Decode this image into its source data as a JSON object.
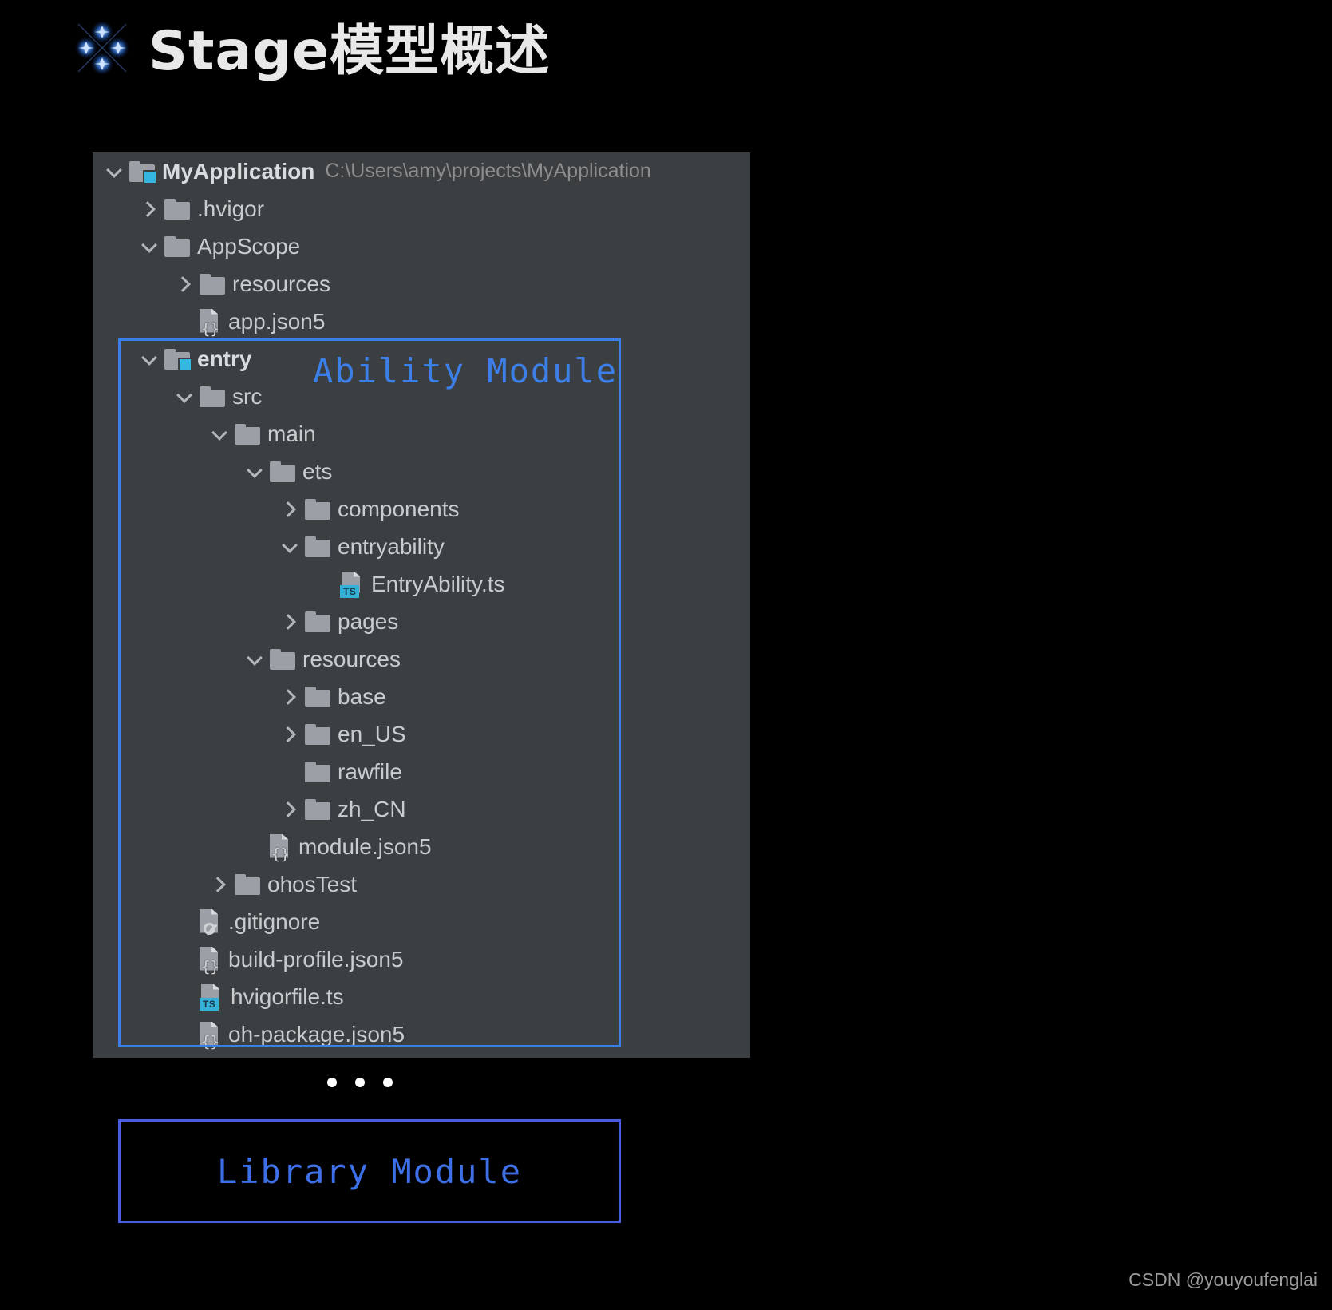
{
  "header": {
    "title": "Stage模型概述",
    "icon": "sparkle-icon"
  },
  "tree": {
    "rows": [
      {
        "indent": 0,
        "chevron": "down",
        "icon": "folder-module",
        "label": "MyApplication",
        "bold": true,
        "path": "C:\\Users\\amy\\projects\\MyApplication"
      },
      {
        "indent": 1,
        "chevron": "right",
        "icon": "folder",
        "label": ".hvigor",
        "bold": false,
        "path": ""
      },
      {
        "indent": 1,
        "chevron": "down",
        "icon": "folder",
        "label": "AppScope",
        "bold": false,
        "path": ""
      },
      {
        "indent": 2,
        "chevron": "right",
        "icon": "folder",
        "label": "resources",
        "bold": false,
        "path": ""
      },
      {
        "indent": 2,
        "chevron": "none",
        "icon": "json5",
        "label": "app.json5",
        "bold": false,
        "path": ""
      },
      {
        "indent": 1,
        "chevron": "down",
        "icon": "folder-module",
        "label": "entry",
        "bold": true,
        "path": ""
      },
      {
        "indent": 2,
        "chevron": "down",
        "icon": "folder",
        "label": "src",
        "bold": false,
        "path": ""
      },
      {
        "indent": 3,
        "chevron": "down",
        "icon": "folder",
        "label": "main",
        "bold": false,
        "path": ""
      },
      {
        "indent": 4,
        "chevron": "down",
        "icon": "folder",
        "label": "ets",
        "bold": false,
        "path": ""
      },
      {
        "indent": 5,
        "chevron": "right",
        "icon": "folder",
        "label": "components",
        "bold": false,
        "path": ""
      },
      {
        "indent": 5,
        "chevron": "down",
        "icon": "folder",
        "label": "entryability",
        "bold": false,
        "path": ""
      },
      {
        "indent": 6,
        "chevron": "none",
        "icon": "ts",
        "label": "EntryAbility.ts",
        "bold": false,
        "path": ""
      },
      {
        "indent": 5,
        "chevron": "right",
        "icon": "folder",
        "label": "pages",
        "bold": false,
        "path": ""
      },
      {
        "indent": 4,
        "chevron": "down",
        "icon": "folder",
        "label": "resources",
        "bold": false,
        "path": ""
      },
      {
        "indent": 5,
        "chevron": "right",
        "icon": "folder",
        "label": "base",
        "bold": false,
        "path": ""
      },
      {
        "indent": 5,
        "chevron": "right",
        "icon": "folder",
        "label": "en_US",
        "bold": false,
        "path": ""
      },
      {
        "indent": 5,
        "chevron": "none",
        "icon": "folder",
        "label": "rawfile",
        "bold": false,
        "path": ""
      },
      {
        "indent": 5,
        "chevron": "right",
        "icon": "folder",
        "label": "zh_CN",
        "bold": false,
        "path": ""
      },
      {
        "indent": 4,
        "chevron": "none",
        "icon": "json5",
        "label": "module.json5",
        "bold": false,
        "path": ""
      },
      {
        "indent": 3,
        "chevron": "right",
        "icon": "folder",
        "label": "ohosTest",
        "bold": false,
        "path": ""
      },
      {
        "indent": 2,
        "chevron": "none",
        "icon": "gitignore",
        "label": ".gitignore",
        "bold": false,
        "path": ""
      },
      {
        "indent": 2,
        "chevron": "none",
        "icon": "json5",
        "label": "build-profile.json5",
        "bold": false,
        "path": ""
      },
      {
        "indent": 2,
        "chevron": "none",
        "icon": "ts",
        "label": "hvigorfile.ts",
        "bold": false,
        "path": ""
      },
      {
        "indent": 2,
        "chevron": "none",
        "icon": "json5",
        "label": "oh-package.json5",
        "bold": false,
        "path": ""
      }
    ]
  },
  "annotations": {
    "ability_module_label": "Ability Module",
    "library_module_label": "Library Module",
    "ellipsis_dots": 3,
    "highlight_color": "#3d7fe8",
    "library_border_color": "#4a5ce0"
  },
  "watermark": {
    "text": "CSDN @youyoufenglai"
  }
}
